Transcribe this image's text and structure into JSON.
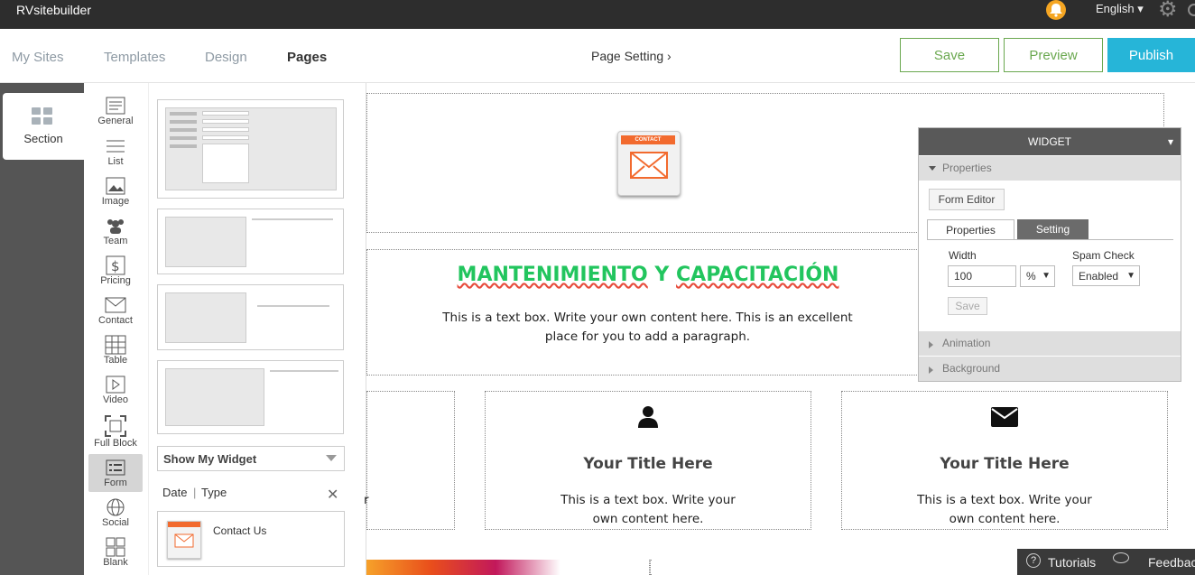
{
  "app": {
    "brand": "RVsitebuilder",
    "language": "English"
  },
  "nav": {
    "tabs": [
      "My Sites",
      "Templates",
      "Design",
      "Pages"
    ],
    "active": "Pages",
    "page_setting": "Page Setting ›",
    "save": "Save",
    "preview": "Preview",
    "publish": "Publish"
  },
  "sidebar": {
    "section_label": "Section",
    "tools": [
      "General",
      "List",
      "Image",
      "Team",
      "Pricing",
      "Contact",
      "Table",
      "Video",
      "Full Block",
      "Form",
      "Social",
      "Blank"
    ],
    "selected": "Form"
  },
  "widget_list": {
    "dropdown": "Show My Widget",
    "sort_date": "Date",
    "sort_sep": "|",
    "sort_type": "Type",
    "my_widget": "Contact Us"
  },
  "canvas": {
    "headline_part1": "MANTENIMIENTO",
    "headline_part2": "Y",
    "headline_part3": "CAPACITACIÓN",
    "intro": "This is a text box. Write your own content here. This is an excellent place for you to add a paragraph.",
    "col_left_partial": "r",
    "col2_title": "Your Title Here",
    "col2_text": "This is a text box. Write your own content here.",
    "col3_title": "Your Title Here",
    "col3_text": "This is a text box. Write your own content here.",
    "mail_badge": "CONTACT"
  },
  "widget_panel": {
    "header": "WIDGET",
    "properties_section": "Properties",
    "form_editor": "Form Editor",
    "tab_properties": "Properties",
    "tab_setting": "Setting",
    "width_label": "Width",
    "width_value": "100",
    "unit_value": "%",
    "spam_label": "Spam Check",
    "spam_value": "Enabled",
    "save": "Save",
    "animation": "Animation",
    "background": "Background"
  },
  "bottom": {
    "tutorials": "Tutorials",
    "feedback": "Feedback"
  },
  "colors": {
    "accent": "#26b5d8",
    "green": "#6aa84f",
    "headline": "#22c55e",
    "orange": "#f26a2e"
  }
}
